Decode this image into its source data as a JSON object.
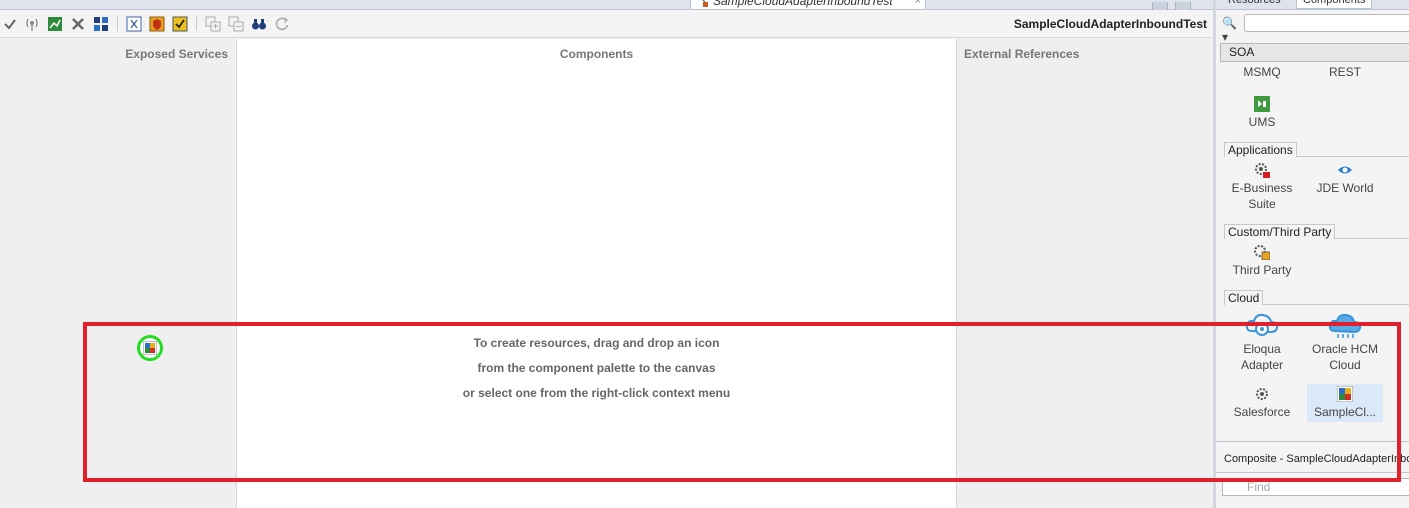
{
  "editor": {
    "tab_title": "SampleCloudAdapterInboundTest",
    "tab_close": "×",
    "composite_name": "SampleCloudAdapterInboundTest"
  },
  "toolbar": {
    "icons": [
      "validate-icon",
      "wsdl-icon",
      "chart-icon",
      "delete-icon",
      "grid-icon",
      "xsd-icon",
      "policy-icon",
      "test-icon",
      "expand-icon",
      "collapse-icon",
      "binoculars-icon",
      "refresh-icon"
    ]
  },
  "canvas": {
    "exposed_title": "Exposed Services",
    "components_title": "Components",
    "external_title": "External References",
    "hint_line1": "To create resources, drag and drop an icon",
    "hint_line2": "from the component palette to the canvas",
    "hint_line3": "or select one from the right-click context menu"
  },
  "panel": {
    "tab_resources": "Resources",
    "tab_components": "Components",
    "search_glyph": "🔍▾",
    "category": "SOA",
    "items": [
      {
        "label": "MSMQ"
      },
      {
        "label": "REST"
      },
      {
        "label": "UMS"
      },
      {
        "label": "E-Business Suite"
      },
      {
        "label": "JDE World"
      },
      {
        "label": "Third Party"
      },
      {
        "label": "Eloqua Adapter"
      },
      {
        "label": "Oracle HCM Cloud"
      },
      {
        "label": "Salesforce"
      },
      {
        "label": "SampleCl..."
      }
    ],
    "sections": {
      "applications": "Applications",
      "custom": "Custom/Third Party",
      "cloud": "Cloud"
    },
    "structure_title": "Composite - SampleCloudAdapterInboundTest",
    "find_placeholder": "Find"
  },
  "colors": {
    "annotation": "#e0202a",
    "highlight_ring": "#22dd22",
    "selected_item": "#dbe8f7"
  }
}
